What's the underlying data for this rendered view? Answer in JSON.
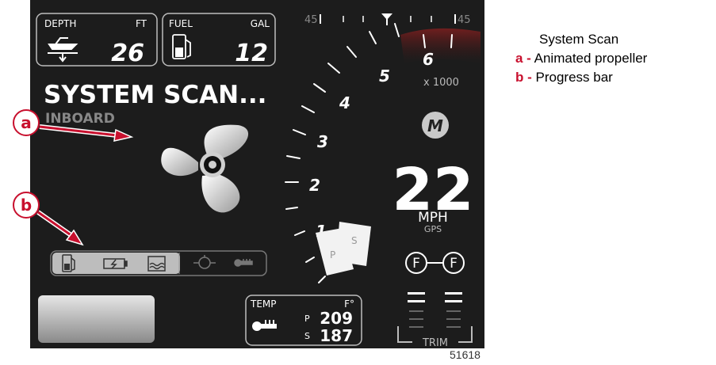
{
  "display": {
    "depth": {
      "label": "DEPTH",
      "unit": "FT",
      "value": "26"
    },
    "fuel": {
      "label": "FUEL",
      "unit": "GAL",
      "value": "12"
    },
    "trim_scale": {
      "left": "45",
      "right": "45"
    },
    "status_title": "SYSTEM SCAN...",
    "status_sub": "INBOARD",
    "rpm_numbers": [
      "1",
      "2",
      "3",
      "4",
      "5",
      "6"
    ],
    "rpm_multiplier": "x 1000",
    "speed": {
      "value": "22",
      "unit": "MPH",
      "source": "GPS"
    },
    "tabs": {
      "port": "P",
      "starboard": "S"
    },
    "temp": {
      "label": "TEMP",
      "unit": "F°",
      "port_label": "P",
      "port_value": "209",
      "starboard_label": "S",
      "starboard_value": "187"
    },
    "fuel_state": {
      "left": "F",
      "right": "F"
    },
    "trim_label": "TRIM",
    "scan_progress_segments": 3,
    "scan_total_segments": 5,
    "progress_icons": [
      "fuel-icon",
      "battery-icon",
      "coolant-icon",
      "engine-icon",
      "temperature-icon"
    ]
  },
  "callouts": {
    "a": "a",
    "b": "b"
  },
  "legend": {
    "title": "System Scan",
    "items": [
      {
        "key": "a -",
        "desc": "Animated propeller"
      },
      {
        "key": "b -",
        "desc": "Progress bar"
      }
    ]
  },
  "figure_id": "51618",
  "colors": {
    "screen": "#1c1c1c",
    "accent": "#c8102e",
    "text": "#ffffff"
  }
}
